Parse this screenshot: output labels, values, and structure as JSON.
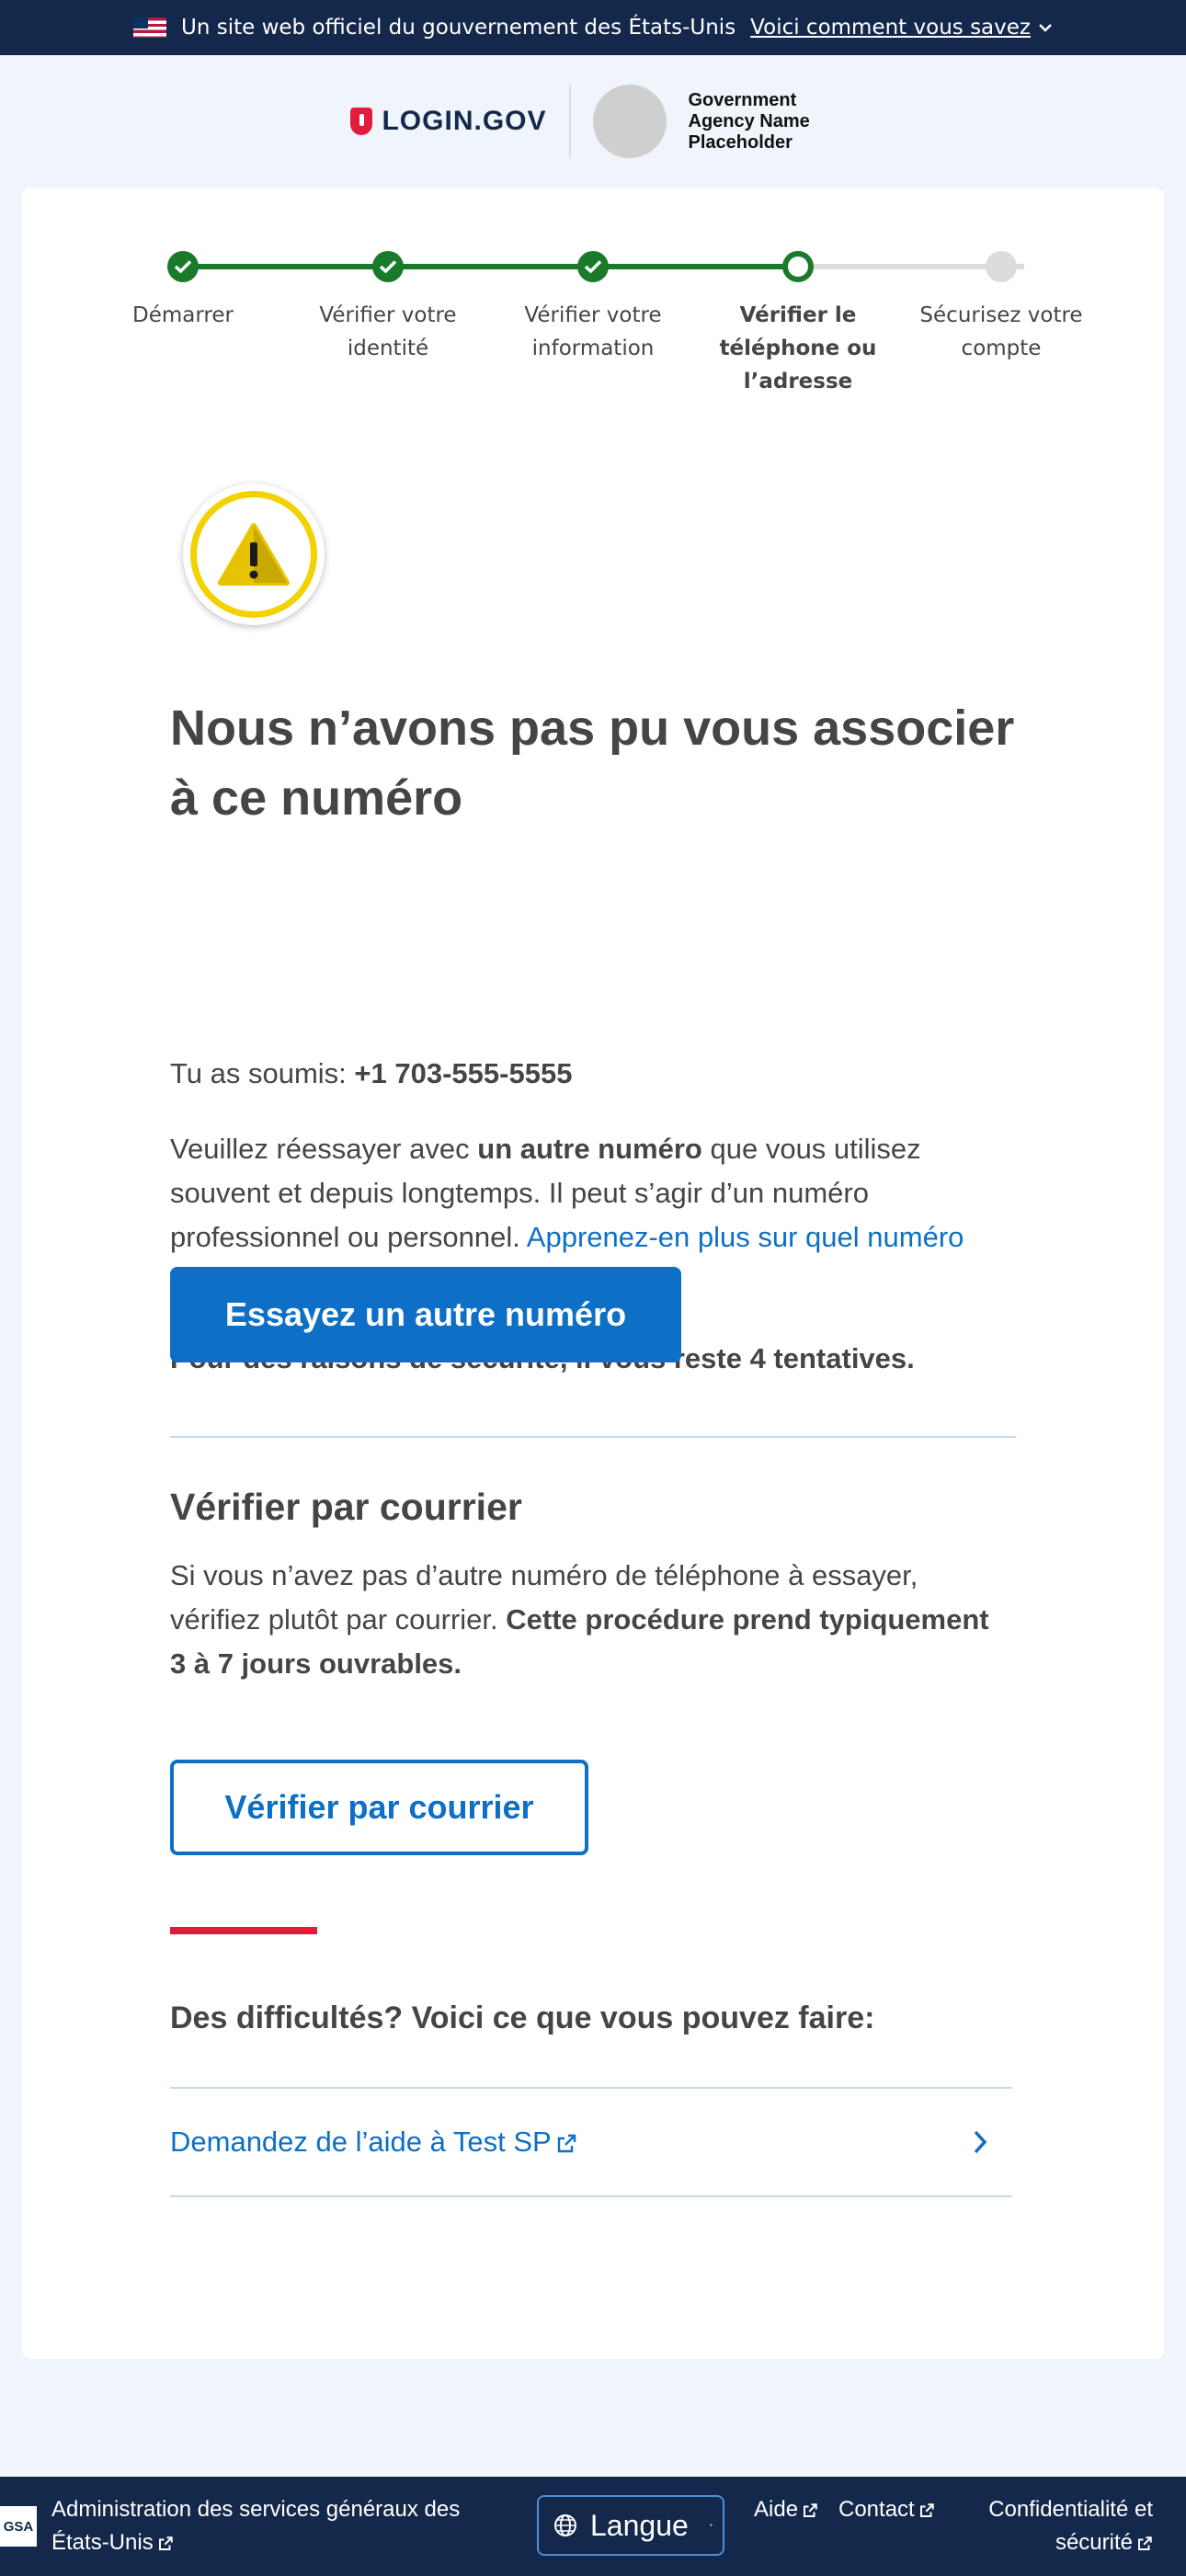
{
  "banner": {
    "official_text": "Un site web officiel du gouvernement des États-Unis",
    "how_link": "Voici comment vous savez"
  },
  "header": {
    "logo_text": "LOGIN.GOV",
    "agency_name": "Government Agency Name Placeholder"
  },
  "steps": [
    {
      "label": "Démarrer",
      "status": "done"
    },
    {
      "label": "Vérifier votre identité",
      "status": "done"
    },
    {
      "label": "Vérifier votre information",
      "status": "done"
    },
    {
      "label": "Vérifier le téléphone ou l’adresse",
      "status": "current"
    },
    {
      "label": "Sécurisez votre compte",
      "status": "todo"
    }
  ],
  "main": {
    "title": "Nous n’avons pas pu vous associer à ce numéro",
    "submitted_prefix": "Tu as soumis: ",
    "submitted_number": "+1 703-555-5555",
    "retry_text_1": "Veuillez réessayer avec ",
    "retry_bold": "un autre numéro",
    "retry_text_2": " que vous utilisez souvent et depuis longtemps. Il peut s’agir d’un numéro professionnel ou personnel. ",
    "learn_more_link": "Apprenez-en plus sur quel numéro de téléphone utiliser",
    "attempts_text": "Pour des raisons de sécurité, il vous reste 4 tentatives.",
    "try_again_button": "Essayez un autre numéro"
  },
  "mail": {
    "heading": "Vérifier par courrier",
    "text_1": "Si vous n’avez pas d’autre numéro de téléphone à essayer, vérifiez plutôt par courrier. ",
    "text_bold": "Cette procédure prend typiquement 3 à 7 jours ouvrables.",
    "button": "Vérifier par courrier"
  },
  "help": {
    "heading": "Des difficultés? Voici ce que vous pouvez faire:",
    "link": "Demandez de l’aide à Test SP"
  },
  "footer": {
    "gsa_logo": "GSA",
    "admin_text": "Administration des services généraux des États-Unis",
    "language_button": "Langue",
    "help_link": "Aide",
    "contact_link": "Contact",
    "privacy_link": "Confidentialité et sécurité"
  },
  "colors": {
    "primary": "#0d6fc5",
    "navy": "#14284b",
    "success": "#1a7a2a",
    "warning": "#f2d200",
    "accent_red": "#e21c3d"
  }
}
